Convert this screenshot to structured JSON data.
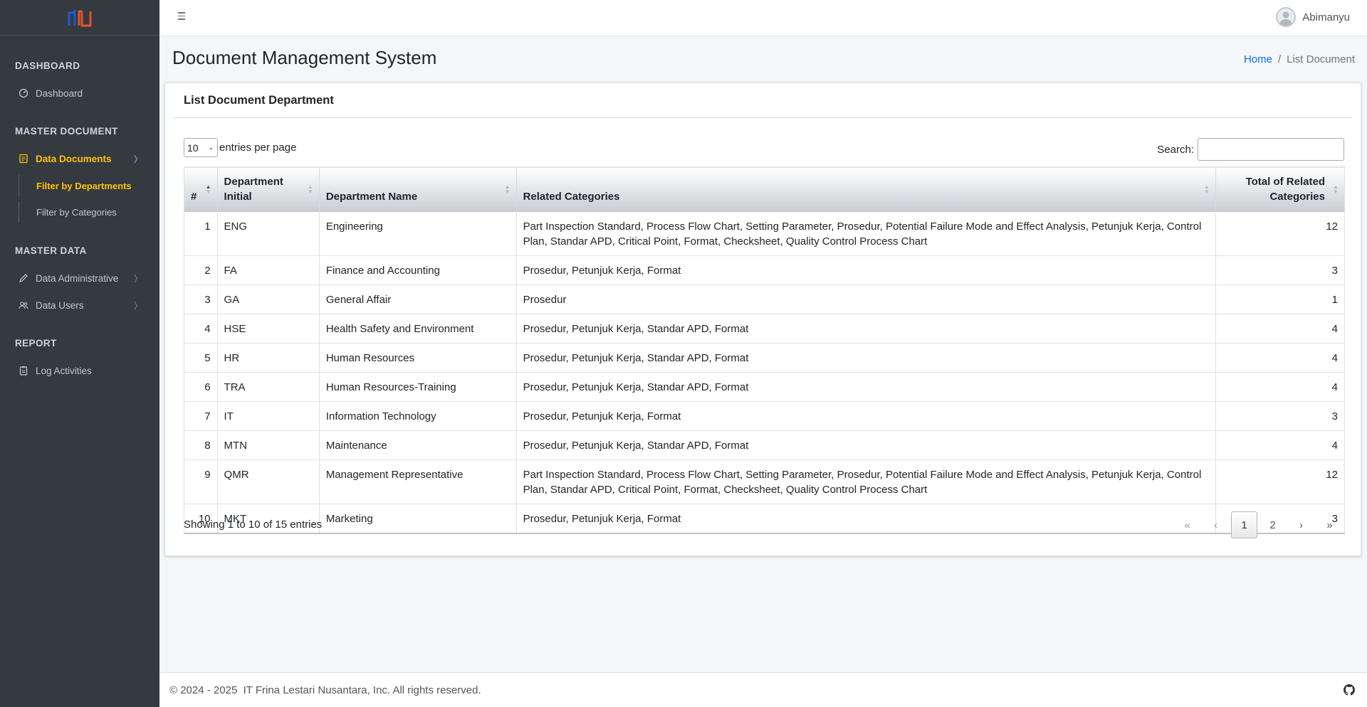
{
  "sidebar": {
    "sections": [
      {
        "header": "DASHBOARD"
      },
      {
        "header": "MASTER DOCUMENT"
      },
      {
        "header": "MASTER DATA"
      },
      {
        "header": "REPORT"
      }
    ],
    "items": {
      "dashboard": "Dashboard",
      "data_documents": "Data Documents",
      "filter_departments": "Filter by Departments",
      "filter_categories": "Filter by Categories",
      "data_administrative": "Data Administrative",
      "data_users": "Data Users",
      "log_activities": "Log Activities"
    },
    "chevron": "〉"
  },
  "topbar": {
    "user_name": "Abimanyu"
  },
  "header": {
    "title": "Document Management System",
    "breadcrumb": {
      "home": "Home",
      "sep": "/",
      "current": "List Document"
    }
  },
  "card": {
    "title": "List Document Department",
    "length_value": "10",
    "length_suffix": "entries per page",
    "search_label": "Search:",
    "search_value": ""
  },
  "table": {
    "columns": [
      "#",
      "Department Initial",
      "Department Name",
      "Related Categories",
      "Total of Related Categories"
    ],
    "rows": [
      [
        "1",
        "ENG",
        "Engineering",
        "Part Inspection Standard, Process Flow Chart, Setting Parameter, Prosedur, Potential Failure Mode and Effect Analysis, Petunjuk Kerja, Control Plan, Standar APD, Critical Point, Format, Checksheet, Quality Control Process Chart",
        "12"
      ],
      [
        "2",
        "FA",
        "Finance and Accounting",
        "Prosedur, Petunjuk Kerja, Format",
        "3"
      ],
      [
        "3",
        "GA",
        "General Affair",
        "Prosedur",
        "1"
      ],
      [
        "4",
        "HSE",
        "Health Safety and Environment",
        "Prosedur, Petunjuk Kerja, Standar APD, Format",
        "4"
      ],
      [
        "5",
        "HR",
        "Human Resources",
        "Prosedur, Petunjuk Kerja, Standar APD, Format",
        "4"
      ],
      [
        "6",
        "TRA",
        "Human Resources-Training",
        "Prosedur, Petunjuk Kerja, Standar APD, Format",
        "4"
      ],
      [
        "7",
        "IT",
        "Information Technology",
        "Prosedur, Petunjuk Kerja, Format",
        "3"
      ],
      [
        "8",
        "MTN",
        "Maintenance",
        "Prosedur, Petunjuk Kerja, Standar APD, Format",
        "4"
      ],
      [
        "9",
        "QMR",
        "Management Representative",
        "Part Inspection Standard, Process Flow Chart, Setting Parameter, Prosedur, Potential Failure Mode and Effect Analysis, Petunjuk Kerja, Control Plan, Standar APD, Critical Point, Format, Checksheet, Quality Control Process Chart",
        "12"
      ],
      [
        "10",
        "MKT",
        "Marketing",
        "Prosedur, Petunjuk Kerja, Format",
        "3"
      ]
    ],
    "info": "Showing 1 to 10 of 15 entries",
    "pagination": {
      "first": "«",
      "prev": "‹",
      "pages": [
        "1",
        "2"
      ],
      "next": "›",
      "last": "»"
    }
  },
  "footer": {
    "text": "© 2024 - 2025  IT Frina Lestari Nusantara, Inc. All rights reserved."
  },
  "colors": {
    "sidebar_bg": "#343a40",
    "active": "#ffc107",
    "link": "#0d6efd"
  }
}
